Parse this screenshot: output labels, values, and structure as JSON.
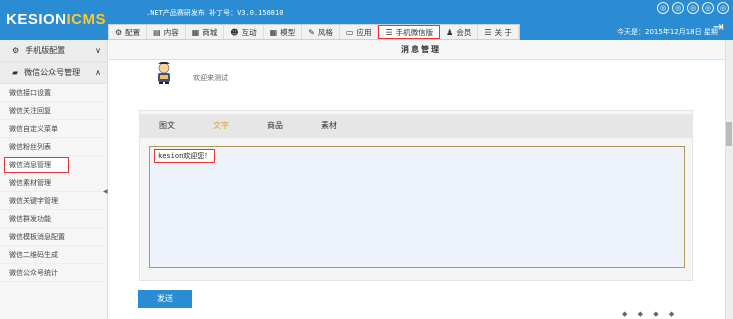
{
  "header": {
    "logo_main": "KESION",
    "logo_suffix": "ICMS",
    "release_text": ".NET产品赛研发布 补丁号：V3.0.150810",
    "release_highlight": "",
    "today": "今天是：2015年12月18日 星期",
    "nav": [
      {
        "label": "配置",
        "icon": "gear-icon",
        "glyph": "⚙"
      },
      {
        "label": "内容",
        "icon": "document-icon",
        "glyph": "▤"
      },
      {
        "label": "商城",
        "icon": "shop-icon",
        "glyph": "▦"
      },
      {
        "label": "互动",
        "icon": "users-icon",
        "glyph": "☻"
      },
      {
        "label": "模型",
        "icon": "grid-icon",
        "glyph": "▦"
      },
      {
        "label": "风格",
        "icon": "tag-icon",
        "glyph": "✎"
      },
      {
        "label": "应用",
        "icon": "monitor-icon",
        "glyph": "▭"
      },
      {
        "label": "手机微信版",
        "icon": "menu-icon",
        "glyph": "☰"
      },
      {
        "label": "会员",
        "icon": "user-icon",
        "glyph": "♟"
      },
      {
        "label": "关 于",
        "icon": "menu-icon",
        "glyph": "☰"
      }
    ],
    "active_nav_index": 7
  },
  "sidebar": {
    "group_mobile": "手机版配置",
    "group_wechat": "微信公众号管理",
    "items": [
      "微信接口设置",
      "微信关注回复",
      "微信自定义菜单",
      "微信粉丝列表",
      "微信消息管理",
      "微信素材管理",
      "微信关键字管理",
      "微信群发功能",
      "微信模板消息配置",
      "微信二维码生成",
      "微信公众号统计"
    ],
    "active_index": 4
  },
  "main": {
    "title": "消息管理",
    "welcome": "欢迎来测试",
    "tabs": [
      "图文",
      "文字",
      "商品",
      "素材"
    ],
    "active_tab": 1,
    "editor_text": "kesion欢迎您！",
    "send_label": "发送"
  },
  "colors": {
    "topbar": "#2a8cd3",
    "logo_suffix": "#f9c92f",
    "highlight_red": "#e33",
    "active_tab": "#e8a02b"
  }
}
